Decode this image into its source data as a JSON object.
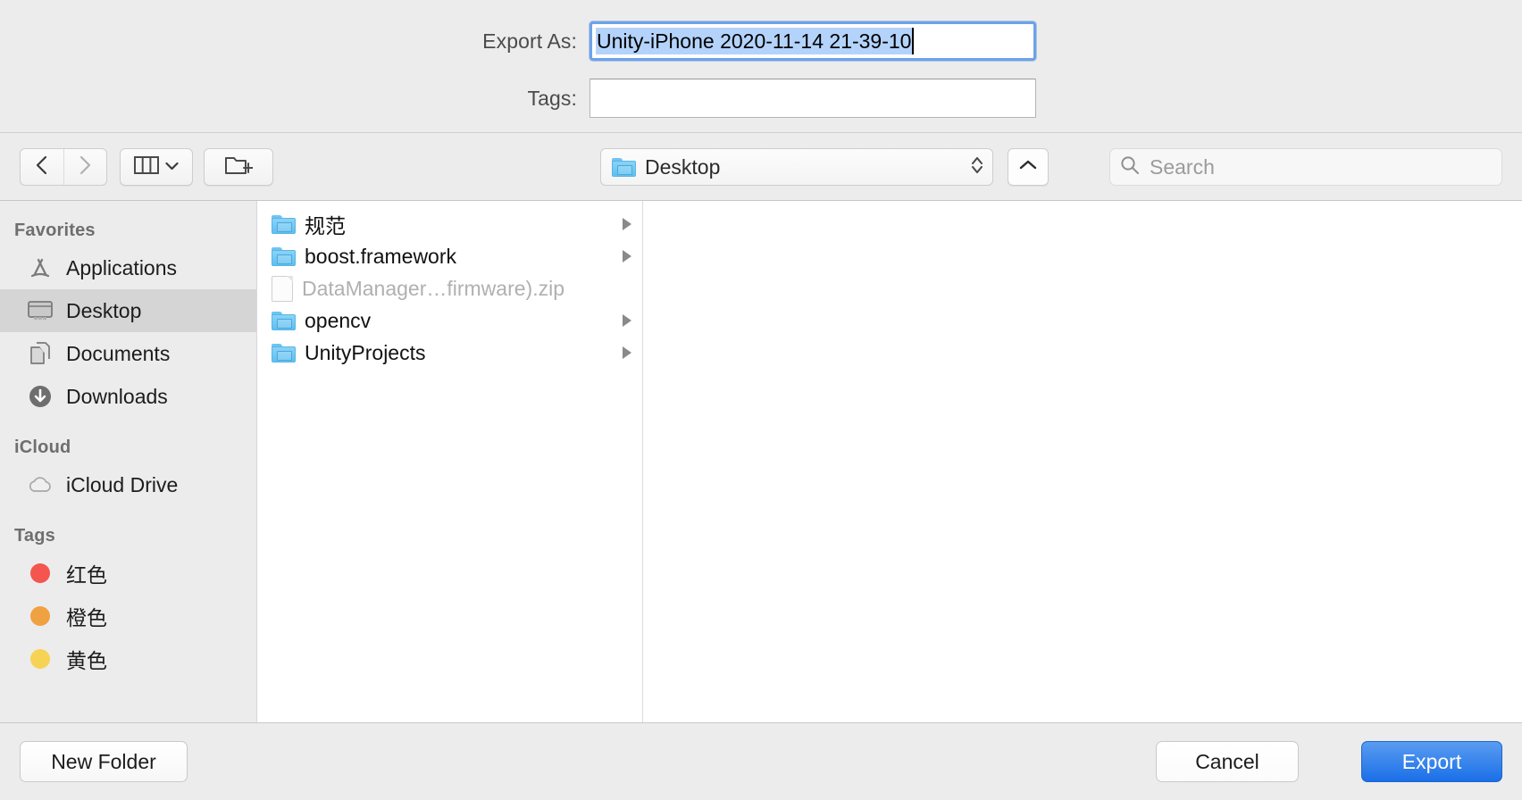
{
  "header": {
    "export_as_label": "Export As:",
    "export_as_value": "Unity-iPhone 2020-11-14 21-39-10",
    "tags_label": "Tags:",
    "tags_value": "",
    "tags_placeholder": ""
  },
  "toolbar": {
    "back_icon": "chevron-left-icon",
    "forward_icon": "chevron-right-icon",
    "view_mode_icon": "column-view-icon",
    "view_mode_chevron": "chevron-down-icon",
    "new_folder_icon": "new-folder-icon",
    "path_label": "Desktop",
    "path_folder_icon": "folder-icon",
    "path_stepper_icon": "up-down-chevron-icon",
    "up_icon": "chevron-up-icon",
    "search_icon": "search-icon",
    "search_placeholder": "Search",
    "search_value": ""
  },
  "sidebar": {
    "sections": [
      {
        "title": "Favorites",
        "items": [
          {
            "label": "Applications",
            "icon": "applications-icon",
            "selected": false
          },
          {
            "label": "Desktop",
            "icon": "desktop-icon",
            "selected": true
          },
          {
            "label": "Documents",
            "icon": "documents-icon",
            "selected": false
          },
          {
            "label": "Downloads",
            "icon": "downloads-icon",
            "selected": false
          }
        ]
      },
      {
        "title": "iCloud",
        "items": [
          {
            "label": "iCloud Drive",
            "icon": "icloud-icon",
            "selected": false
          }
        ]
      },
      {
        "title": "Tags",
        "items": [
          {
            "label": "红色",
            "icon": "tag-dot-icon",
            "color": "#f4554f",
            "selected": false
          },
          {
            "label": "橙色",
            "icon": "tag-dot-icon",
            "color": "#f0a142",
            "selected": false
          },
          {
            "label": "黄色",
            "icon": "tag-dot-icon",
            "color": "#f6d354",
            "selected": false
          }
        ]
      }
    ]
  },
  "filelist": {
    "items": [
      {
        "name": "规范",
        "type": "folder",
        "has_children": true,
        "disabled": false
      },
      {
        "name": "boost.framework",
        "type": "folder",
        "has_children": true,
        "disabled": false
      },
      {
        "name": "DataManager…firmware).zip",
        "type": "file",
        "has_children": false,
        "disabled": true
      },
      {
        "name": "opencv",
        "type": "folder",
        "has_children": true,
        "disabled": false
      },
      {
        "name": "UnityProjects",
        "type": "folder",
        "has_children": true,
        "disabled": false
      }
    ]
  },
  "footer": {
    "new_folder_label": "New Folder",
    "cancel_label": "Cancel",
    "export_label": "Export"
  },
  "colors": {
    "accent": "#1a6fe8",
    "selection": "#b4d3fb",
    "folder": "#6fc4f2",
    "sidebar_selected": "#d5d5d5"
  }
}
